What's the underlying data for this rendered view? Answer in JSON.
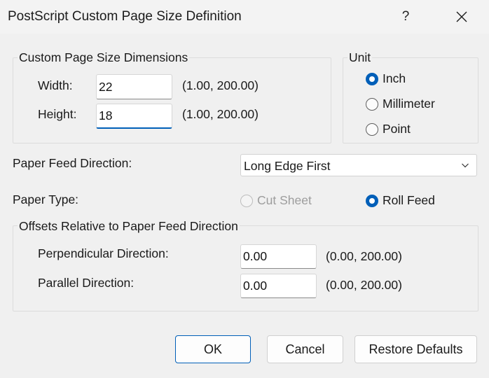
{
  "window": {
    "title": "PostScript Custom Page Size Definition",
    "help_label": "?"
  },
  "dimensions": {
    "group_label": "Custom Page Size Dimensions",
    "width_label": "Width:",
    "width_value": "22",
    "width_range": "(1.00, 200.00)",
    "height_label": "Height:",
    "height_value": "18",
    "height_range": "(1.00, 200.00)"
  },
  "unit": {
    "group_label": "Unit",
    "options": [
      {
        "label": "Inch",
        "checked": true
      },
      {
        "label": "Millimeter",
        "checked": false
      },
      {
        "label": "Point",
        "checked": false
      }
    ]
  },
  "paper_feed": {
    "label": "Paper Feed Direction:",
    "selected": "Long Edge First"
  },
  "paper_type": {
    "label": "Paper Type:",
    "cut_sheet": "Cut Sheet",
    "cut_sheet_enabled": false,
    "roll_feed": "Roll Feed",
    "roll_feed_checked": true
  },
  "offsets": {
    "group_label": "Offsets Relative to Paper Feed Direction",
    "perpendicular_label": "Perpendicular Direction:",
    "perpendicular_value": "0.00",
    "perpendicular_range": "(0.00, 200.00)",
    "parallel_label": "Parallel Direction:",
    "parallel_value": "0.00",
    "parallel_range": "(0.00, 200.00)"
  },
  "buttons": {
    "ok": "OK",
    "cancel": "Cancel",
    "restore": "Restore Defaults"
  },
  "colors": {
    "accent": "#005fb8",
    "background": "#f0f0f0"
  },
  "icons": {
    "close": "close-icon",
    "dropdown": "chevron-down-icon"
  }
}
